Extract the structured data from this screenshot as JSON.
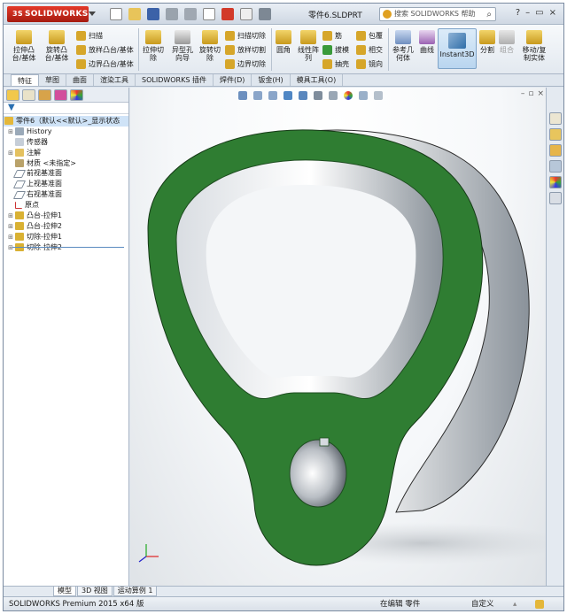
{
  "app": {
    "logo_text": "SOLIDWORKS",
    "logo_prefix": "3S",
    "document_title": "零件6.SLDPRT",
    "help_search_placeholder": "搜索 SOLIDWORKS 帮助"
  },
  "ribbon": {
    "boss_extrude": "拉伸凸台/基体",
    "revolve_boss": "旋转凸台/基体",
    "sweep": "扫描",
    "loft": "放样凸台/基体",
    "boundary_boss": "边界凸台/基体",
    "extrude_cut": "拉伸切除",
    "hole_wizard": "异型孔向导",
    "revolve_cut": "旋转切除",
    "swept_cut": "扫描切除",
    "lofted_cut": "放样切割",
    "boundary_cut": "边界切除",
    "fillet": "圆角",
    "linear_pattern": "线性阵列",
    "rib": "筋",
    "draft": "拔模",
    "shell": "抽壳",
    "wrap": "包覆",
    "intersect": "相交",
    "mirror": "镜向",
    "ref_geometry": "参考几何体",
    "curves": "曲线",
    "instant3d": "Instant3D",
    "split": "分割",
    "combine": "组合",
    "move_copy": "移动/复制实体"
  },
  "tabs": [
    "特征",
    "草图",
    "曲面",
    "渲染工具",
    "SOLIDWORKS 插件",
    "焊件(D)",
    "钣金(H)",
    "模具工具(O)"
  ],
  "feature_tree": {
    "root": "零件6（默认<<默认>_显示状态",
    "items": [
      {
        "label": "History",
        "icon": "history-icon"
      },
      {
        "label": "传感器",
        "icon": "sensor-icon"
      },
      {
        "label": "注解",
        "icon": "annotation-icon"
      },
      {
        "label": "材质 <未指定>",
        "icon": "material-icon"
      },
      {
        "label": "前视基准面",
        "icon": "plane-icon"
      },
      {
        "label": "上视基准面",
        "icon": "plane-icon"
      },
      {
        "label": "右视基准面",
        "icon": "plane-icon"
      },
      {
        "label": "原点",
        "icon": "origin-icon"
      },
      {
        "label": "凸台-拉伸1",
        "icon": "extrude-icon"
      },
      {
        "label": "凸台-拉伸2",
        "icon": "extrude-icon"
      },
      {
        "label": "切除-拉伸1",
        "icon": "cut-icon"
      },
      {
        "label": "切除-拉伸2",
        "icon": "cut-icon"
      }
    ]
  },
  "bottom_tabs": [
    "模型",
    "3D 视图",
    "运动算例 1"
  ],
  "status": {
    "product": "SOLIDWORKS Premium 2015 x64 版",
    "mode": "在编辑 零件",
    "units": "自定义"
  },
  "colors": {
    "part_green": "#2f7d32",
    "accent_blue": "#2a6fb0"
  }
}
